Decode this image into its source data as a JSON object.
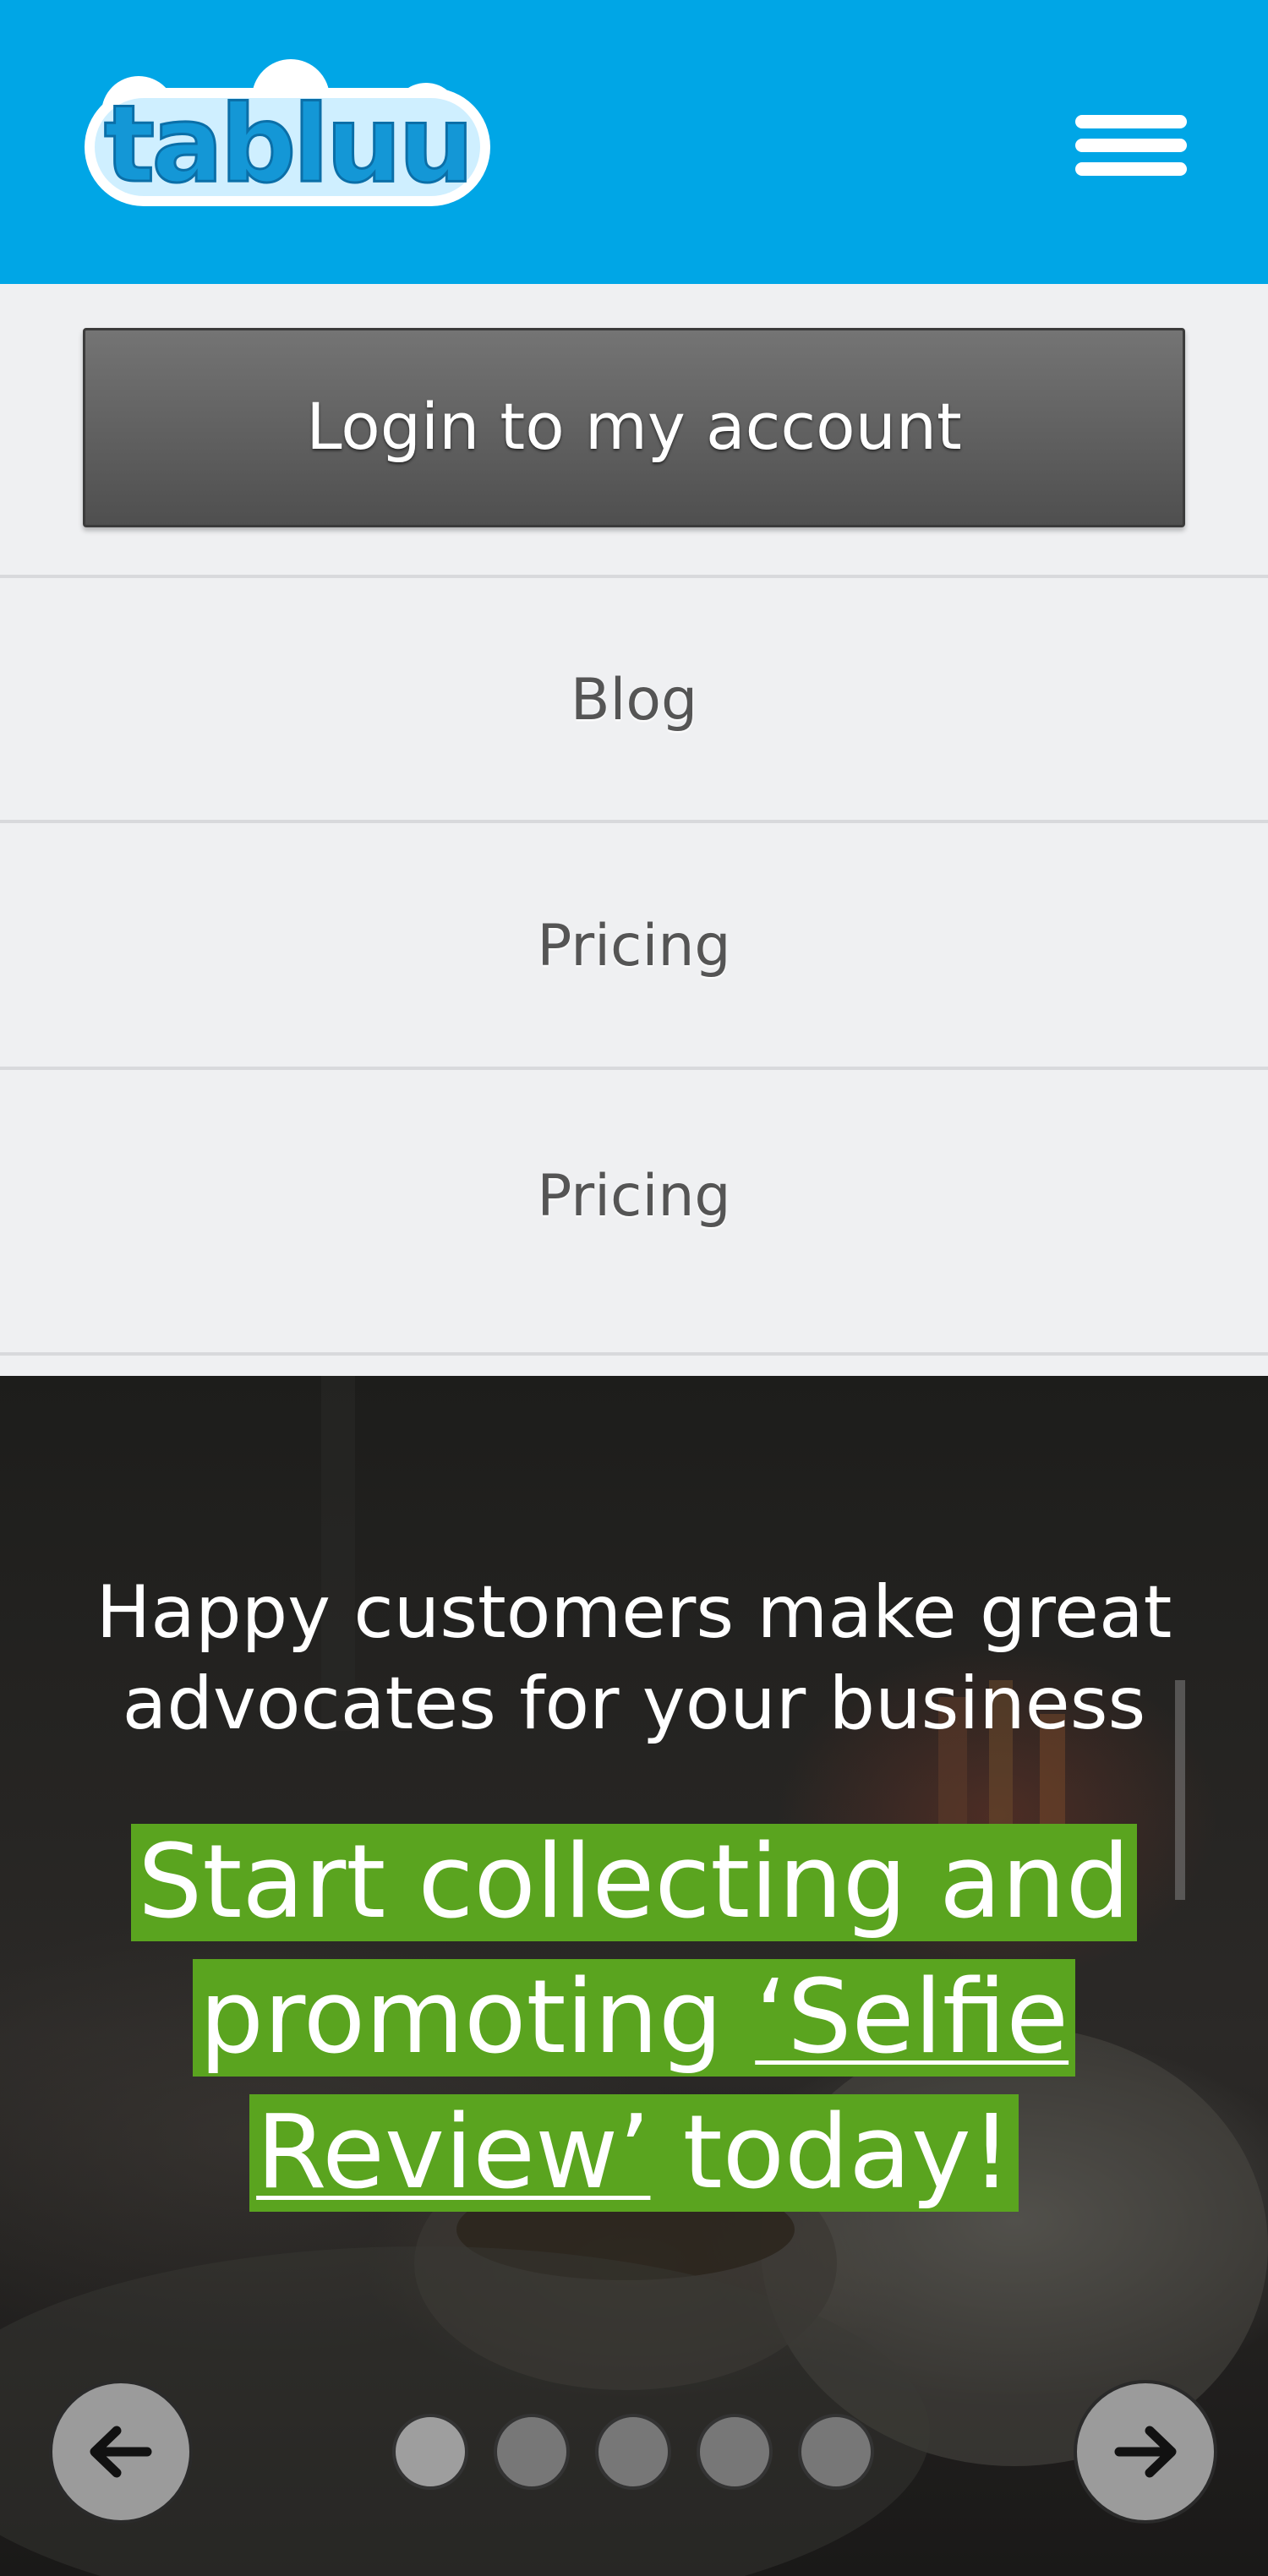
{
  "header": {
    "logo_text": "tabluu",
    "menu_icon": "hamburger-menu-icon",
    "background_color": "#00a6e6"
  },
  "menu": {
    "login_label": "Login to my account",
    "items": [
      {
        "label": "Blog"
      },
      {
        "label": "Pricing"
      },
      {
        "label": "Pricing"
      }
    ]
  },
  "hero": {
    "subtitle_line1": "Happy customers make great",
    "subtitle_line2": "advocates for your business",
    "cta_part1": "Start collecting and promoting",
    "cta_link": "‘Selfie Review’",
    "cta_part2": "today!",
    "highlight_color": "#5aa41f",
    "prev_icon": "arrow-left-icon",
    "next_icon": "arrow-right-icon",
    "slide_count": 5,
    "active_slide": 1
  }
}
